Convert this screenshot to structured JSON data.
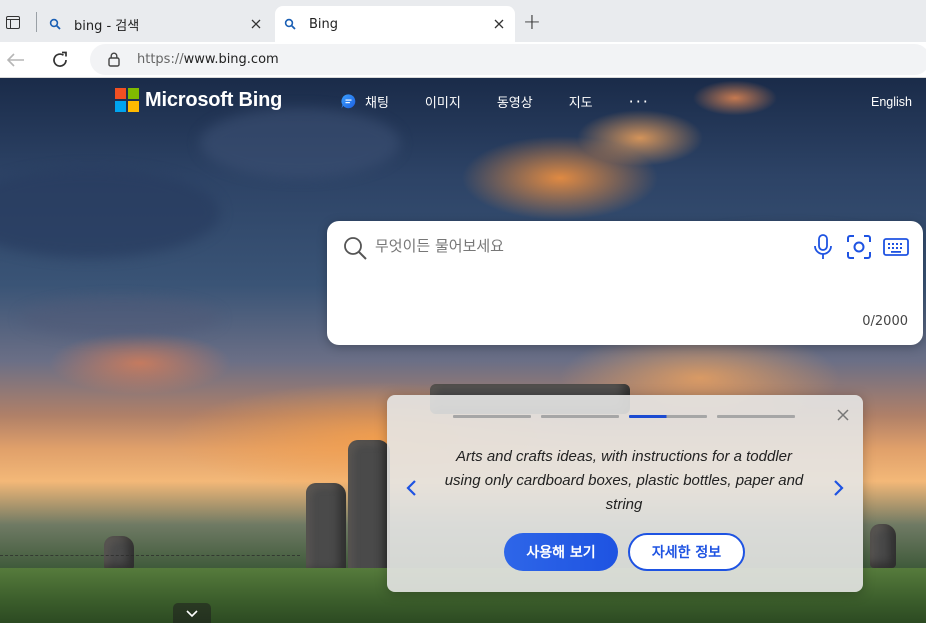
{
  "browser": {
    "tabs": [
      {
        "title": "bing - 검색",
        "favicon": "bing-search-icon",
        "active": false
      },
      {
        "title": "Bing",
        "favicon": "bing-search-icon",
        "active": true
      }
    ],
    "new_tab_symbol": "+",
    "address": {
      "prefix": "https://",
      "host": "www.bing.com"
    }
  },
  "header": {
    "logo_text": "Microsoft Bing",
    "logo_colors": [
      "#f25022",
      "#7fba00",
      "#00a4ef",
      "#ffb900"
    ],
    "nav": [
      {
        "label": "채팅",
        "icon": "chat-bubble-icon"
      },
      {
        "label": "이미지"
      },
      {
        "label": "동영상"
      },
      {
        "label": "지도"
      },
      {
        "label": "···"
      }
    ],
    "language_link": "English"
  },
  "search": {
    "placeholder": "무엇이든 물어보세요",
    "char_counter": "0/2000",
    "icons": [
      "search-icon",
      "microphone-icon",
      "visual-search-icon",
      "keyboard-icon"
    ]
  },
  "suggestion_card": {
    "carousel_position": {
      "active_index": 3,
      "total": 4
    },
    "text": "Arts and crafts ideas, with instructions for a toddler using only cardboard boxes, plastic bottles, paper and string",
    "try_button": "사용해 보기",
    "more_button": "자세한 정보"
  },
  "colors": {
    "accent_blue": "#1e53e2",
    "tab_bar": "#e9ebee"
  }
}
